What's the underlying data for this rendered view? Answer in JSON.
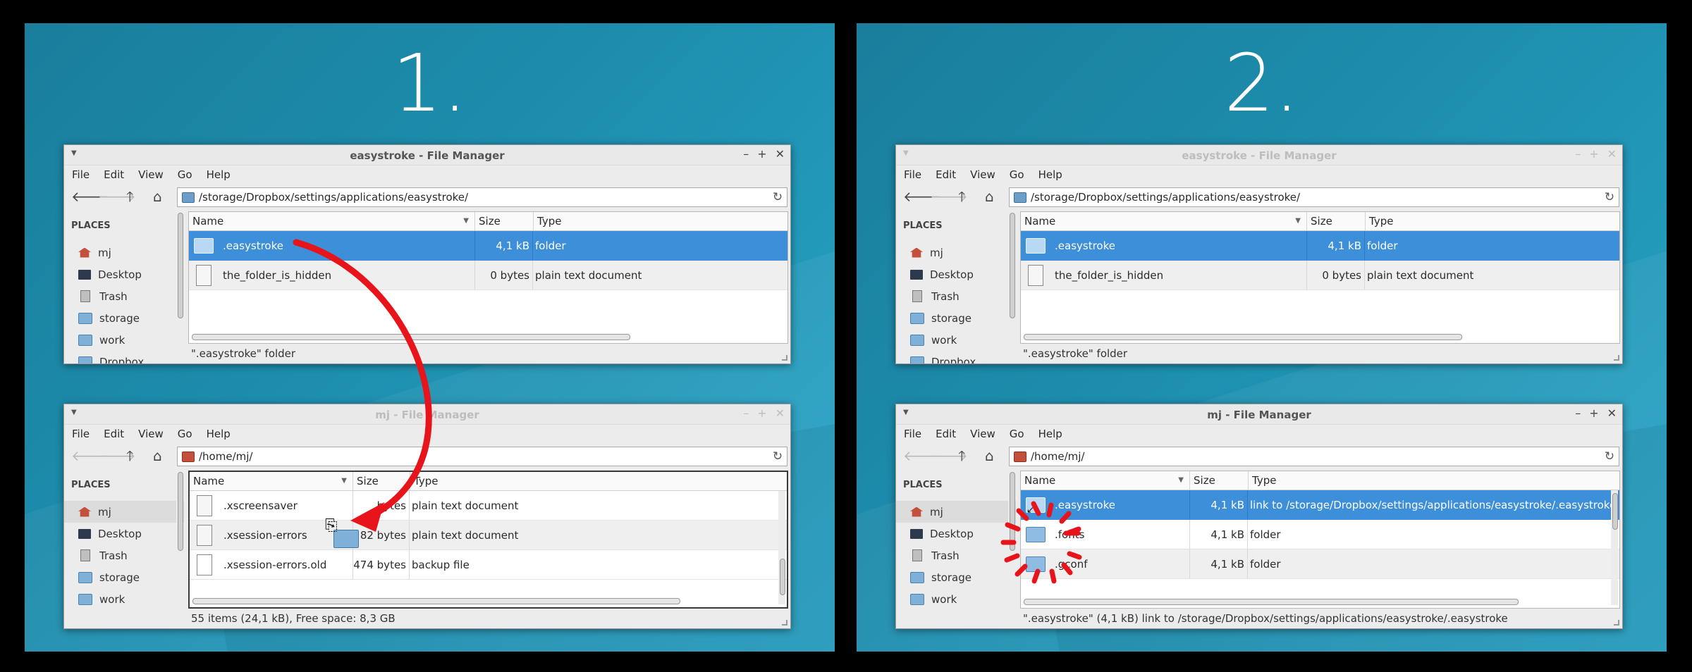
{
  "panels": [
    {
      "step": "1.",
      "top_window": {
        "title": "easystroke - File Manager",
        "active": true,
        "menu": [
          "File",
          "Edit",
          "View",
          "Go",
          "Help"
        ],
        "path": "/storage/Dropbox/settings/applications/easystroke/",
        "places_header": "PLACES",
        "places": [
          {
            "label": "mj",
            "icon": "home-icon"
          },
          {
            "label": "Desktop",
            "icon": "desktop-icon"
          },
          {
            "label": "Trash",
            "icon": "trash-icon"
          },
          {
            "label": "storage",
            "icon": "folder-icon"
          },
          {
            "label": "work",
            "icon": "folder-icon"
          },
          {
            "label": "Dropbox",
            "icon": "folder-icon"
          }
        ],
        "columns": {
          "name": "Name",
          "size": "Size",
          "type": "Type"
        },
        "files": [
          {
            "name": ".easystroke",
            "size": "4,1 kB",
            "type": "folder",
            "icon": "folder-icon",
            "selected": true
          },
          {
            "name": "the_folder_is_hidden",
            "size": "0 bytes",
            "type": "plain text document",
            "icon": "document-icon",
            "selected": false
          }
        ],
        "status": "\".easystroke\" folder"
      },
      "bottom_window": {
        "title": "mj - File Manager",
        "active": false,
        "menu": [
          "File",
          "Edit",
          "View",
          "Go",
          "Help"
        ],
        "path": "/home/mj/",
        "places_header": "PLACES",
        "places": [
          {
            "label": "mj",
            "icon": "home-icon",
            "active": true
          },
          {
            "label": "Desktop",
            "icon": "desktop-icon"
          },
          {
            "label": "Trash",
            "icon": "trash-icon"
          },
          {
            "label": "storage",
            "icon": "folder-icon"
          },
          {
            "label": "work",
            "icon": "folder-icon"
          }
        ],
        "columns": {
          "name": "Name",
          "size": "Size",
          "type": "Type"
        },
        "files": [
          {
            "name": ".xscreensaver",
            "size": "bytes",
            "type": "plain text document",
            "icon": "document-icon"
          },
          {
            "name": ".xsession-errors",
            "size": "82 bytes",
            "type": "plain text document",
            "icon": "document-icon"
          },
          {
            "name": ".xsession-errors.old",
            "size": "474 bytes",
            "type": "backup file",
            "icon": "document-icon"
          }
        ],
        "status": "55 items (24,1 kB), Free space: 8,3 GB"
      }
    },
    {
      "step": "2.",
      "top_window": {
        "title": "easystroke - File Manager",
        "active": false,
        "menu": [
          "File",
          "Edit",
          "View",
          "Go",
          "Help"
        ],
        "path": "/storage/Dropbox/settings/applications/easystroke/",
        "places_header": "PLACES",
        "places": [
          {
            "label": "mj",
            "icon": "home-icon"
          },
          {
            "label": "Desktop",
            "icon": "desktop-icon"
          },
          {
            "label": "Trash",
            "icon": "trash-icon"
          },
          {
            "label": "storage",
            "icon": "folder-icon"
          },
          {
            "label": "work",
            "icon": "folder-icon"
          },
          {
            "label": "Dropbox",
            "icon": "folder-icon"
          }
        ],
        "columns": {
          "name": "Name",
          "size": "Size",
          "type": "Type"
        },
        "files": [
          {
            "name": ".easystroke",
            "size": "4,1 kB",
            "type": "folder",
            "icon": "folder-icon",
            "selected": true
          },
          {
            "name": "the_folder_is_hidden",
            "size": "0 bytes",
            "type": "plain text document",
            "icon": "document-icon",
            "selected": false
          }
        ],
        "status": "\".easystroke\" folder"
      },
      "bottom_window": {
        "title": "mj - File Manager",
        "active": true,
        "menu": [
          "File",
          "Edit",
          "View",
          "Go",
          "Help"
        ],
        "path": "/home/mj/",
        "places_header": "PLACES",
        "places": [
          {
            "label": "mj",
            "icon": "home-icon",
            "active": true
          },
          {
            "label": "Desktop",
            "icon": "desktop-icon"
          },
          {
            "label": "Trash",
            "icon": "trash-icon"
          },
          {
            "label": "storage",
            "icon": "folder-icon"
          },
          {
            "label": "work",
            "icon": "folder-icon"
          }
        ],
        "columns": {
          "name": "Name",
          "size": "Size",
          "type": "Type"
        },
        "files": [
          {
            "name": ".easystroke",
            "size": "4,1 kB",
            "type": "link to /storage/Dropbox/settings/applications/easystroke/.easystroke",
            "icon": "folder-link-icon",
            "selected": true
          },
          {
            "name": ".fonts",
            "size": "4,1 kB",
            "type": "folder",
            "icon": "folder-icon"
          },
          {
            "name": ".gconf",
            "size": "4,1 kB",
            "type": "folder",
            "icon": "folder-icon"
          }
        ],
        "status": "\".easystroke\" (4,1 kB) link to /storage/Dropbox/settings/applications/easystroke/.easystroke"
      }
    }
  ],
  "colors": {
    "background": "#1d8eae",
    "selection": "#3c8fd8",
    "annotation": "#e8141b"
  }
}
